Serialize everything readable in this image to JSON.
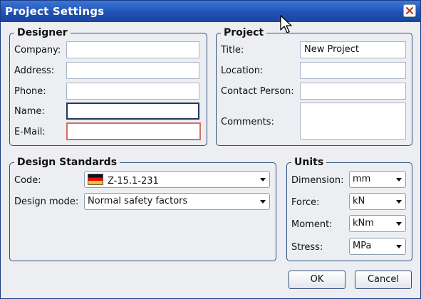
{
  "window": {
    "title": "Project Settings"
  },
  "designer": {
    "legend": "Designer",
    "company_label": "Company:",
    "address_label": "Address:",
    "phone_label": "Phone:",
    "name_label": "Name:",
    "email_label": "E-Mail:",
    "company_value": "",
    "address_value": "",
    "phone_value": "",
    "name_value": "",
    "email_value": ""
  },
  "project": {
    "legend": "Project",
    "title_label": "Title:",
    "title_value": "New Project",
    "location_label": "Location:",
    "location_value": "",
    "contact_label": "Contact Person:",
    "contact_value": "",
    "comments_label": "Comments:",
    "comments_value": ""
  },
  "design_standards": {
    "legend": "Design Standards",
    "code_label": "Code:",
    "code_value": "Z-15.1-231",
    "mode_label": "Design mode:",
    "mode_value": "Normal safety factors"
  },
  "units": {
    "legend": "Units",
    "dimension_label": "Dimension:",
    "dimension_value": "mm",
    "force_label": "Force:",
    "force_value": "kN",
    "moment_label": "Moment:",
    "moment_value": "kNm",
    "stress_label": "Stress:",
    "stress_value": "MPa"
  },
  "buttons": {
    "ok": "OK",
    "cancel": "Cancel"
  },
  "colors": {
    "titlebar": "#1f4fb0",
    "group_border": "#2d4f7f",
    "error_border": "#d26d6d"
  },
  "icons": {
    "close": "close-icon",
    "cursor": "mouse-pointer-icon",
    "flag": "flag-icon"
  }
}
